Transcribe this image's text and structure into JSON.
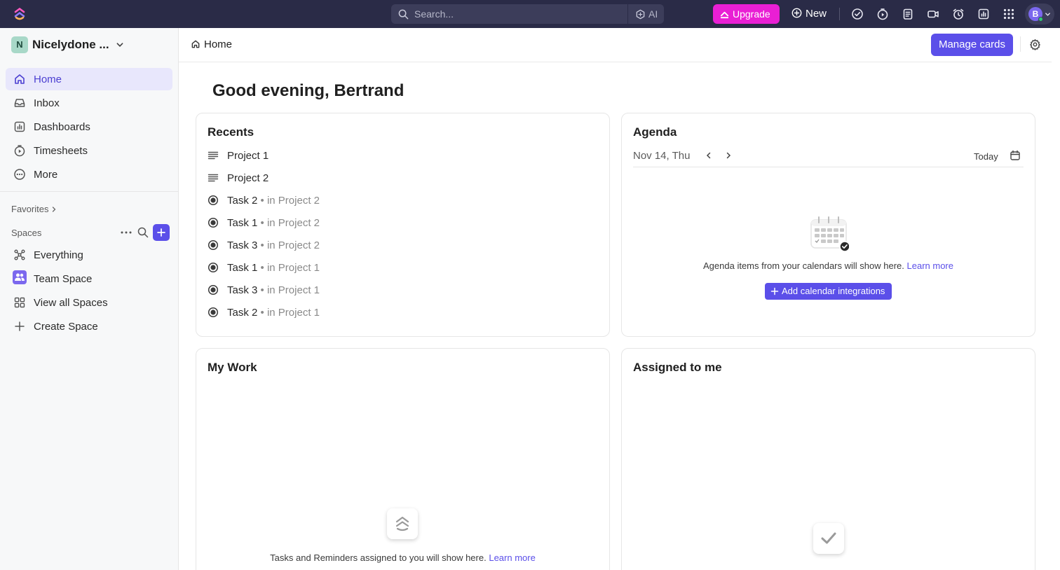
{
  "colors": {
    "topbar": "#2a2b47",
    "accent": "#5b4fe9",
    "upgrade": "#e91fd4",
    "active_nav_bg": "#e8e7fc"
  },
  "topbar": {
    "search_placeholder": "Search...",
    "ai_label": "AI",
    "upgrade_label": "Upgrade",
    "new_label": "New",
    "icons": [
      "check-circle-icon",
      "timer-icon",
      "notepad-icon",
      "video-icon",
      "alarm-icon",
      "dashboard-icon",
      "apps-grid-icon"
    ],
    "avatar_initial": "B"
  },
  "sidebar": {
    "workspace_initial": "N",
    "workspace_name": "Nicelydone ...",
    "nav": [
      {
        "label": "Home",
        "icon": "home-icon",
        "active": true
      },
      {
        "label": "Inbox",
        "icon": "inbox-icon"
      },
      {
        "label": "Dashboards",
        "icon": "dashboards-icon"
      },
      {
        "label": "Timesheets",
        "icon": "timesheets-icon"
      },
      {
        "label": "More",
        "icon": "more-circle-icon"
      }
    ],
    "favorites_label": "Favorites",
    "spaces_label": "Spaces",
    "spaces": [
      {
        "label": "Everything",
        "icon": "everything-icon"
      },
      {
        "label": "Team Space",
        "icon": "team-icon"
      },
      {
        "label": "View all Spaces",
        "icon": "grid-icon"
      },
      {
        "label": "Create Space",
        "icon": "plus-icon"
      }
    ]
  },
  "header": {
    "breadcrumb": "Home",
    "manage_cards_label": "Manage cards"
  },
  "greeting": "Good evening, Bertrand",
  "recents": {
    "title": "Recents",
    "items": [
      {
        "name": "Project 1",
        "location": "",
        "kind": "list"
      },
      {
        "name": "Project 2",
        "location": "",
        "kind": "list"
      },
      {
        "name": "Task 2",
        "location": "in Project 2",
        "kind": "task"
      },
      {
        "name": "Task 1",
        "location": "in Project 2",
        "kind": "task"
      },
      {
        "name": "Task 3",
        "location": "in Project 2",
        "kind": "task"
      },
      {
        "name": "Task 1",
        "location": "in Project 1",
        "kind": "task"
      },
      {
        "name": "Task 3",
        "location": "in Project 1",
        "kind": "task"
      },
      {
        "name": "Task 2",
        "location": "in Project 1",
        "kind": "task"
      }
    ]
  },
  "agenda": {
    "title": "Agenda",
    "date": "Nov 14, Thu",
    "today_label": "Today",
    "message": "Agenda items from your calendars will show here.",
    "learn_more": "Learn more",
    "add_button": "Add calendar integrations"
  },
  "my_work": {
    "title": "My Work",
    "message": "Tasks and Reminders assigned to you will show here.",
    "learn_more": "Learn more"
  },
  "assigned": {
    "title": "Assigned to me"
  }
}
